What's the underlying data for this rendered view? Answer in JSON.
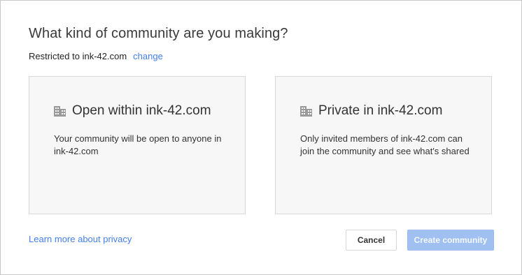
{
  "dialog": {
    "title": "What kind of community are you making?",
    "restriction": {
      "label": "Restricted to ink-42.com",
      "change_link": "change"
    },
    "options": [
      {
        "icon": "building-icon",
        "title": "Open within ink-42.com",
        "description": "Your community will be open to anyone in ink-42.com"
      },
      {
        "icon": "building-icon",
        "title": "Private in ink-42.com",
        "description": "Only invited members of ink-42.com can join the community and see what's shared"
      }
    ],
    "learn_more": "Learn more about privacy",
    "cancel_label": "Cancel",
    "create_label": "Create community"
  },
  "colors": {
    "link": "#427fed",
    "create_button_disabled": "#a0c0f2",
    "card_background": "#f7f7f7"
  }
}
